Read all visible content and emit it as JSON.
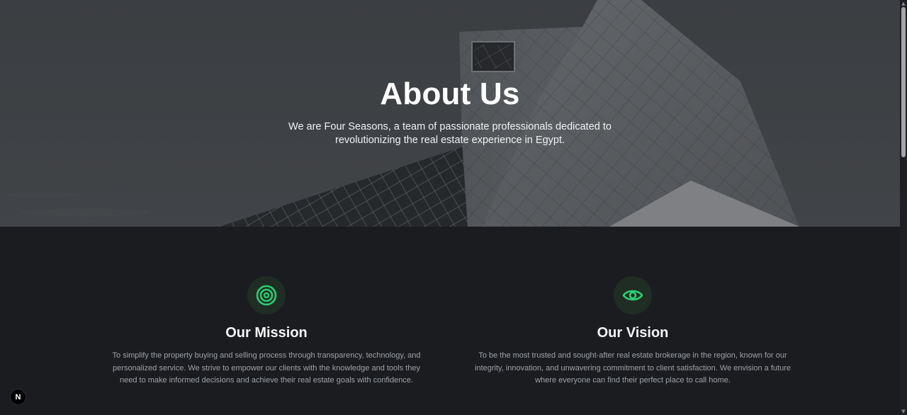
{
  "hero": {
    "title": "About Us",
    "subtitle": "We are Four Seasons, a team of passionate professionals dedicated to revolutionizing the real estate experience in Egypt."
  },
  "mission": {
    "icon": "target-icon",
    "title": "Our Mission",
    "text": "To simplify the property buying and selling process through transparency, technology, and personalized service. We strive to empower our clients with the knowledge and tools they need to make informed decisions and achieve their real estate goals with confidence."
  },
  "vision": {
    "icon": "eye-icon",
    "title": "Our Vision",
    "text": "To be the most trusted and sought-after real estate brokerage in the region, known for our integrity, innovation, and unwavering commitment to client satisfaction. We envision a future where everyone can find their perfect place to call home."
  },
  "badge": {
    "label": "N"
  },
  "colors": {
    "accent": "#2ecc71",
    "background": "#1b1c1f",
    "icon_circle": "#1f2d25"
  }
}
